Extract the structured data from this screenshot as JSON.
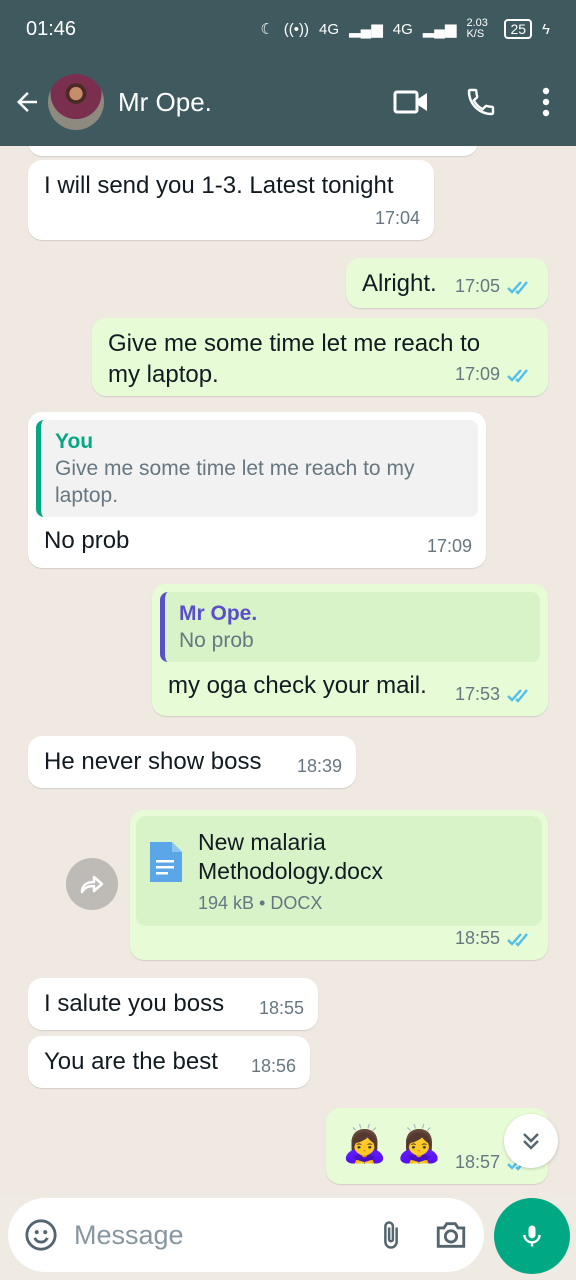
{
  "status_bar": {
    "time": "01:46",
    "net1": "4G",
    "net2": "4G",
    "speed": "2.03 K/S",
    "battery": "25"
  },
  "header": {
    "contact_name": "Mr Ope."
  },
  "messages": [
    {
      "text": "I will send you 1-3. Latest tonight",
      "time": "17:04"
    },
    {
      "text": "Alright.",
      "time": "17:05"
    },
    {
      "text": "Give me some time let me reach to my laptop.",
      "time": "17:09"
    },
    {
      "quote_name": "You",
      "quote_text": "Give me some time let me reach to my laptop.",
      "text": "No prob",
      "time": "17:09"
    },
    {
      "quote_name": "Mr Ope.",
      "quote_text": "No prob",
      "text": "my oga check your mail.",
      "time": "17:53"
    },
    {
      "text": "He never show boss",
      "time": "18:39"
    },
    {
      "file_name": "New malaria Methodology.docx",
      "file_meta": "194 kB • DOCX",
      "time": "18:55"
    },
    {
      "text": "I salute you boss",
      "time": "18:55"
    },
    {
      "text": "You are the best",
      "time": "18:56"
    },
    {
      "text": "🙇‍♀️ 🙇‍♀️",
      "time": "18:57"
    }
  ],
  "input": {
    "placeholder": "Message"
  },
  "colors": {
    "header_bg": "#3f5a5f",
    "outgoing_bubble": "#e7fcd6",
    "incoming_bubble": "#ffffff",
    "accent": "#00a884",
    "read_tick": "#53bdeb",
    "quote_you": "#06a884",
    "quote_other": "#5b4fc9"
  },
  "icons": [
    "back-arrow-icon",
    "video-call-icon",
    "phone-icon",
    "menu-dots-icon",
    "double-check-icon",
    "document-icon",
    "forward-icon",
    "emoji-icon",
    "attach-icon",
    "camera-icon",
    "mic-icon",
    "scroll-down-icon"
  ]
}
